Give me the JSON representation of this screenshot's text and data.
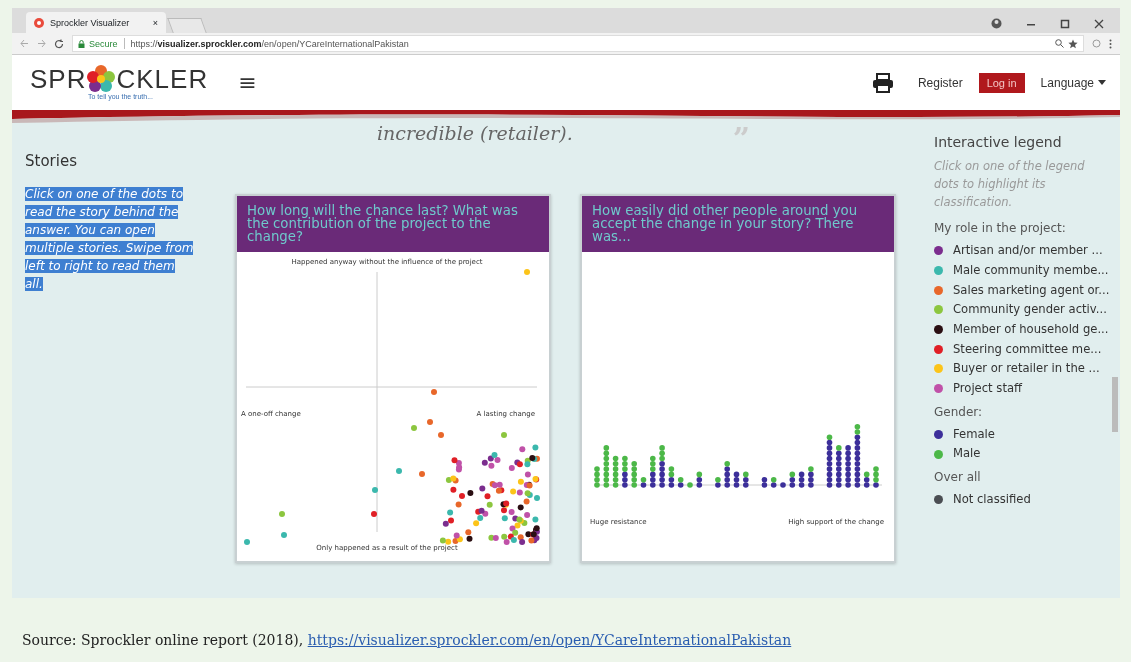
{
  "browser": {
    "tab_title": "Sprockler Visualizer",
    "tab_close": "×",
    "secure_label": "Secure",
    "url_scheme": "https://",
    "url_host": "visualizer.sprockler.com",
    "url_path": "/en/open/YCareInternationalPakistan"
  },
  "header": {
    "logo_left": "SPR",
    "logo_right": "CKLER",
    "tagline": "To tell you the truth...",
    "menu_glyph": "≡",
    "register": "Register",
    "login": "Log in",
    "language": "Language"
  },
  "quote": {
    "text": "incredible (retailer).",
    "mark": "”"
  },
  "stories": {
    "title": "Stories",
    "instructions": "Click on one of the dots to read the story behind the answer. You can open multiple stories. Swipe from left to right to read them all."
  },
  "charts": [
    {
      "kind": "scatter",
      "title": "How long will the chance last? What was the contribution of the project to the change?",
      "top_label": "Happened anyway without the influence of the project",
      "bottom_label": "Only happened as a result of the project",
      "left_label": "A one-off change",
      "right_label": "A lasting change"
    },
    {
      "kind": "dots",
      "title": "How easily did other people around you accept the change in your story? There was...",
      "left_label": "Huge resistance",
      "right_label": "High support of the change"
    }
  ],
  "legend": {
    "title": "Interactive legend",
    "hint": "Click on one of the legend dots to highlight its classification.",
    "groups": [
      {
        "title": "My role in the project:",
        "items": [
          {
            "label": "Artisan and/or member ...",
            "color": "#7b2d8e"
          },
          {
            "label": "Male community membe...",
            "color": "#3bb8ad"
          },
          {
            "label": "Sales marketing agent or...",
            "color": "#e8672a"
          },
          {
            "label": "Community gender activ...",
            "color": "#8cc63f"
          },
          {
            "label": "Member of household ge...",
            "color": "#2a0e12"
          },
          {
            "label": "Steering committee me...",
            "color": "#e01f26"
          },
          {
            "label": "Buyer or retailer in the ...",
            "color": "#fcc419"
          },
          {
            "label": "Project staff",
            "color": "#c051a8"
          }
        ]
      },
      {
        "title": "Gender:",
        "items": [
          {
            "label": "Female",
            "color": "#3c2f9a"
          },
          {
            "label": "Male",
            "color": "#4cb848"
          }
        ]
      },
      {
        "title": "Over all",
        "items": [
          {
            "label": "Not classified",
            "color": "#4a4d52"
          }
        ]
      }
    ]
  },
  "caption": {
    "text": "Source: Sprockler online report (2018), ",
    "link": "https://visualizer.sprockler.com/en/open/YCareInternationalPakistan"
  }
}
